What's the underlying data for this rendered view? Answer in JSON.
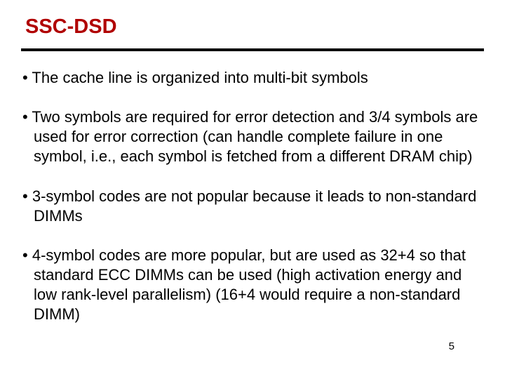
{
  "title": "SSC-DSD",
  "bullets": [
    "The cache line is organized into multi-bit symbols",
    "Two symbols are required for error detection and 3/4 symbols are used for error correction (can handle complete failure in one symbol, i.e., each symbol is fetched from a different DRAM chip)",
    "3-symbol codes are not popular because it leads to non-standard DIMMs",
    "4-symbol codes are more popular, but are used as 32+4 so that standard ECC DIMMs can be used (high activation energy and low rank-level parallelism) (16+4 would require a non-standard DIMM)"
  ],
  "page_number": "5"
}
